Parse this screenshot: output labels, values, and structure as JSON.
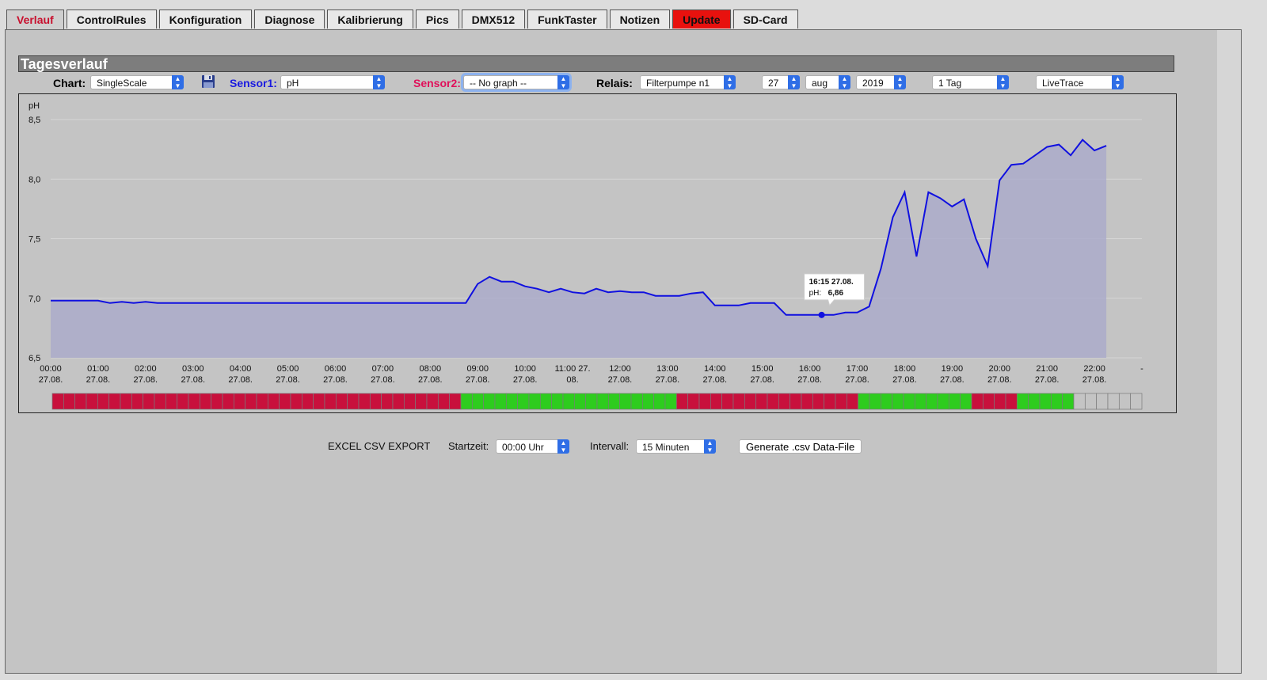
{
  "tabs": [
    {
      "label": "Verlauf",
      "state": "active"
    },
    {
      "label": "ControlRules",
      "state": ""
    },
    {
      "label": "Konfiguration",
      "state": ""
    },
    {
      "label": "Diagnose",
      "state": ""
    },
    {
      "label": "Kalibrierung",
      "state": ""
    },
    {
      "label": "Pics",
      "state": ""
    },
    {
      "label": "DMX512",
      "state": ""
    },
    {
      "label": "FunkTaster",
      "state": ""
    },
    {
      "label": "Notizen",
      "state": ""
    },
    {
      "label": "Update",
      "state": "alert"
    },
    {
      "label": "SD-Card",
      "state": ""
    }
  ],
  "section_title": "Tagesverlauf",
  "controls": {
    "chart_label": "Chart:",
    "chart_value": "SingleScale",
    "sensor1_label": "Sensor1:",
    "sensor1_value": "pH",
    "sensor2_label": "Sensor2:",
    "sensor2_value": "-- No graph --",
    "relais_label": "Relais:",
    "relais_value": "Filterpumpe n1",
    "day_value": "27",
    "month_value": "aug",
    "year_value": "2019",
    "range_value": "1 Tag",
    "mode_value": "LiveTrace"
  },
  "colors": {
    "sensor1": "#1010e0",
    "sensor2": "#e0105a",
    "relay_on": "#2ecc1e",
    "relay_off": "#c8103c",
    "update_tab": "#e8110e"
  },
  "chart_data": {
    "type": "area",
    "ylabel": "pH",
    "ylim": [
      6.5,
      8.5
    ],
    "yticks": [
      "6,5",
      "7,0",
      "7,5",
      "8,0",
      "8,5"
    ],
    "xticks": [
      {
        "top": "00:00",
        "bottom": "27.08."
      },
      {
        "top": "01:00",
        "bottom": "27.08."
      },
      {
        "top": "02:00",
        "bottom": "27.08."
      },
      {
        "top": "03:00",
        "bottom": "27.08."
      },
      {
        "top": "04:00",
        "bottom": "27.08."
      },
      {
        "top": "05:00",
        "bottom": "27.08."
      },
      {
        "top": "06:00",
        "bottom": "27.08."
      },
      {
        "top": "07:00",
        "bottom": "27.08."
      },
      {
        "top": "08:00",
        "bottom": "27.08."
      },
      {
        "top": "09:00",
        "bottom": "27.08."
      },
      {
        "top": "10:00",
        "bottom": "27.08."
      },
      {
        "top": "11:00 27.",
        "bottom": "08."
      },
      {
        "top": "12:00",
        "bottom": "27.08."
      },
      {
        "top": "13:00",
        "bottom": "27.08."
      },
      {
        "top": "14:00",
        "bottom": "27.08."
      },
      {
        "top": "15:00",
        "bottom": "27.08."
      },
      {
        "top": "16:00",
        "bottom": "27.08."
      },
      {
        "top": "17:00",
        "bottom": "27.08."
      },
      {
        "top": "18:00",
        "bottom": "27.08."
      },
      {
        "top": "19:00",
        "bottom": "27.08."
      },
      {
        "top": "20:00",
        "bottom": "27.08."
      },
      {
        "top": "21:00",
        "bottom": "27.08."
      },
      {
        "top": "22:00",
        "bottom": "27.08."
      },
      {
        "top": "-",
        "bottom": ""
      }
    ],
    "x_hours": [
      0,
      0.25,
      0.5,
      0.75,
      1.0,
      1.25,
      1.5,
      1.75,
      2.0,
      2.25,
      8.75,
      9.0,
      9.25,
      9.5,
      9.75,
      10.0,
      10.25,
      10.5,
      10.75,
      11.0,
      11.25,
      11.5,
      11.75,
      12.0,
      12.25,
      12.5,
      12.75,
      13.0,
      13.25,
      13.5,
      13.75,
      14.0,
      14.25,
      14.5,
      14.75,
      15.0,
      15.25,
      15.5,
      15.75,
      16.0,
      16.25,
      16.5,
      16.75,
      17.0,
      17.25,
      17.5,
      17.75,
      18.0,
      18.25,
      18.5,
      18.75,
      19.0,
      19.25,
      19.5,
      19.75,
      20.0,
      20.25,
      20.5,
      20.75,
      21.0,
      21.25,
      21.5,
      21.75,
      22.0,
      22.25
    ],
    "series": [
      {
        "values": [
          6.98,
          6.98,
          6.98,
          6.98,
          6.98,
          6.96,
          6.97,
          6.96,
          6.97,
          6.96,
          6.96,
          7.12,
          7.18,
          7.14,
          7.14,
          7.1,
          7.08,
          7.05,
          7.08,
          7.05,
          7.04,
          7.08,
          7.05,
          7.06,
          7.05,
          7.05,
          7.02,
          7.02,
          7.02,
          7.04,
          7.05,
          6.94,
          6.94,
          6.94,
          6.96,
          6.96,
          6.96,
          6.86,
          6.86,
          6.86,
          6.86,
          6.86,
          6.88,
          6.88,
          6.93,
          7.25,
          7.68,
          7.89,
          7.35,
          7.89,
          7.84,
          7.77,
          7.83,
          7.5,
          7.27,
          7.99,
          8.12,
          8.13,
          8.2,
          8.27,
          8.29,
          8.2,
          8.33,
          8.24,
          8.28
        ]
      }
    ],
    "tooltip": {
      "title": "16:15 27.08.",
      "label": "pH:",
      "value": "6,86",
      "x_hour": 16.25,
      "y": 6.86
    },
    "relay_segments": [
      {
        "state": "off",
        "count": 36
      },
      {
        "state": "on",
        "count": 19
      },
      {
        "state": "off",
        "count": 16
      },
      {
        "state": "on",
        "count": 10
      },
      {
        "state": "off",
        "count": 4
      },
      {
        "state": "on",
        "count": 5
      },
      {
        "state": "none",
        "count": 6
      }
    ]
  },
  "export": {
    "title": "EXCEL CSV EXPORT",
    "start_label": "Startzeit:",
    "start_value": "00:00 Uhr",
    "interval_label": "Intervall:",
    "interval_value": "15 Minuten",
    "button": "Generate .csv Data-File"
  }
}
